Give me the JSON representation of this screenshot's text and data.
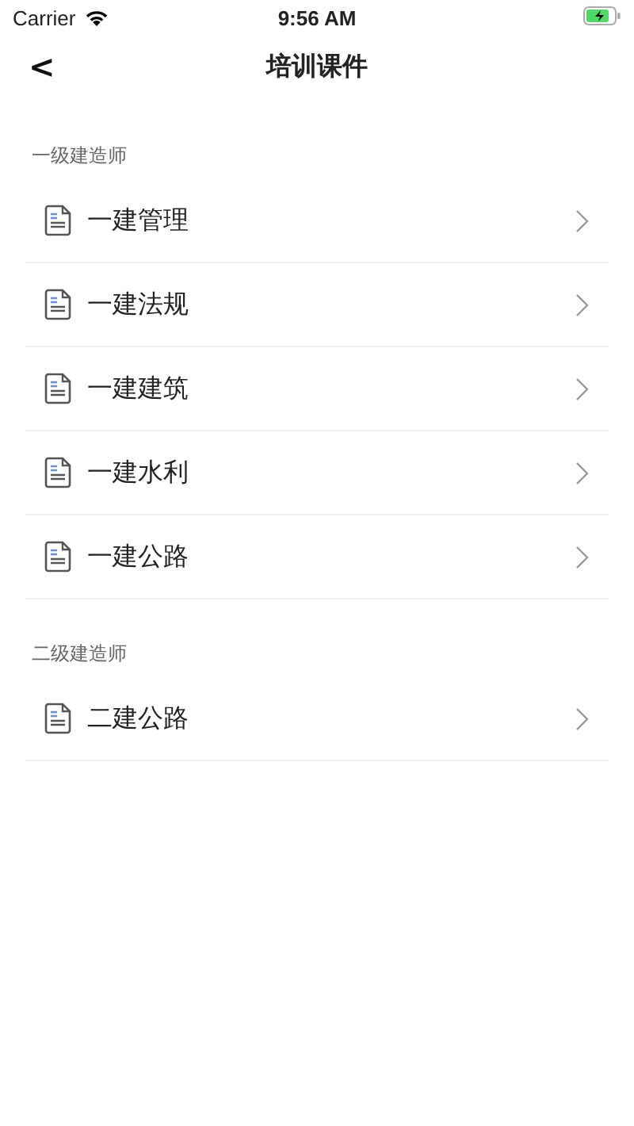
{
  "status_bar": {
    "carrier": "Carrier",
    "time": "9:56 AM"
  },
  "nav": {
    "back": "<",
    "title": "培训课件"
  },
  "sections": [
    {
      "header": "一级建造师",
      "items": [
        {
          "label": "一建管理"
        },
        {
          "label": "一建法规"
        },
        {
          "label": "一建建筑"
        },
        {
          "label": "一建水利"
        },
        {
          "label": "一建公路"
        }
      ]
    },
    {
      "header": "二级建造师",
      "items": [
        {
          "label": "二建公路"
        }
      ]
    }
  ]
}
